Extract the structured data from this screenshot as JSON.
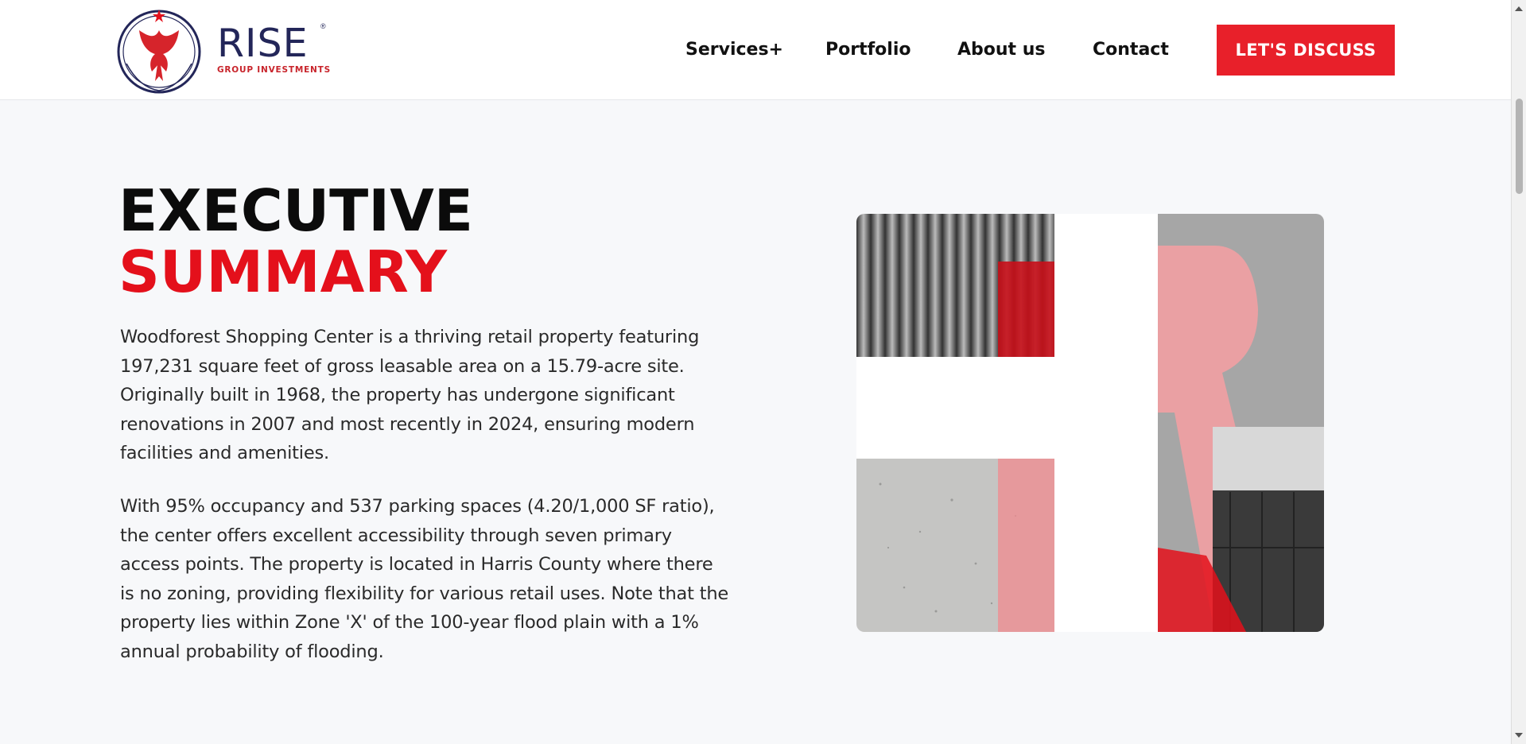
{
  "brand": {
    "name": "RISE",
    "registered": "®",
    "tagline": "GROUP INVESTMENTS",
    "colors": {
      "navy": "#232659",
      "red": "#e4101b"
    }
  },
  "nav": {
    "items": [
      {
        "label": "Services+"
      },
      {
        "label": "Portfolio"
      },
      {
        "label": "About us"
      },
      {
        "label": "Contact"
      }
    ],
    "cta_label": "LET'S DISCUSS"
  },
  "summary": {
    "title_line1": "EXECUTIVE",
    "title_line2": "SUMMARY",
    "paragraph1": "Woodforest Shopping Center is a thriving retail property featuring 197,231 square feet of gross leasable area on a 15.79-acre site. Originally built in 1968, the property has undergone significant renovations in 2007 and most recently in 2024, ensuring modern facilities and amenities.",
    "paragraph2": "With 95% occupancy and 537 parking spaces (4.20/1,000 SF ratio), the center offers excellent accessibility through seven primary access points. The property is located in Harris County where there is no zoning, providing flexibility for various retail uses. Note that the property lies within Zone 'X' of the 100-year flood plain with a 1% annual probability of flooding."
  }
}
